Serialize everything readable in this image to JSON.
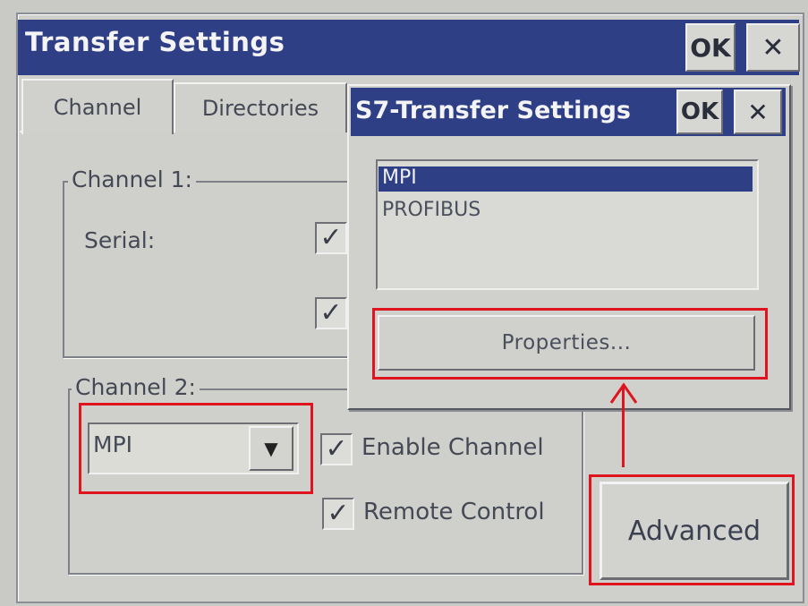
{
  "main_window": {
    "title": "Transfer Settings",
    "ok_label": "OK",
    "close_label": "✕"
  },
  "tabs": [
    {
      "label": "Channel",
      "active": true
    },
    {
      "label": "Directories",
      "active": false
    }
  ],
  "channel1": {
    "label": "Channel 1:",
    "serial_label": "Serial:",
    "checkboxes": [
      {
        "checked": true
      },
      {
        "checked": true
      }
    ]
  },
  "channel2": {
    "label": "Channel 2:",
    "protocol_value": "MPI",
    "enable_channel": {
      "label": "Enable Channel",
      "checked": true
    },
    "remote_control": {
      "label": "Remote Control",
      "checked": true
    }
  },
  "advanced_label": "Advanced",
  "s7_dialog": {
    "title": "S7-Transfer Settings",
    "ok_label": "OK",
    "close_label": "✕",
    "list_items": [
      "MPI",
      "PROFIBUS"
    ],
    "selected_item": "MPI",
    "properties_label": "Properties..."
  },
  "annotation_color": "#e0141e",
  "icons": [
    "checkmark-icon",
    "dropdown-arrow-icon",
    "close-icon",
    "up-arrow-icon"
  ]
}
